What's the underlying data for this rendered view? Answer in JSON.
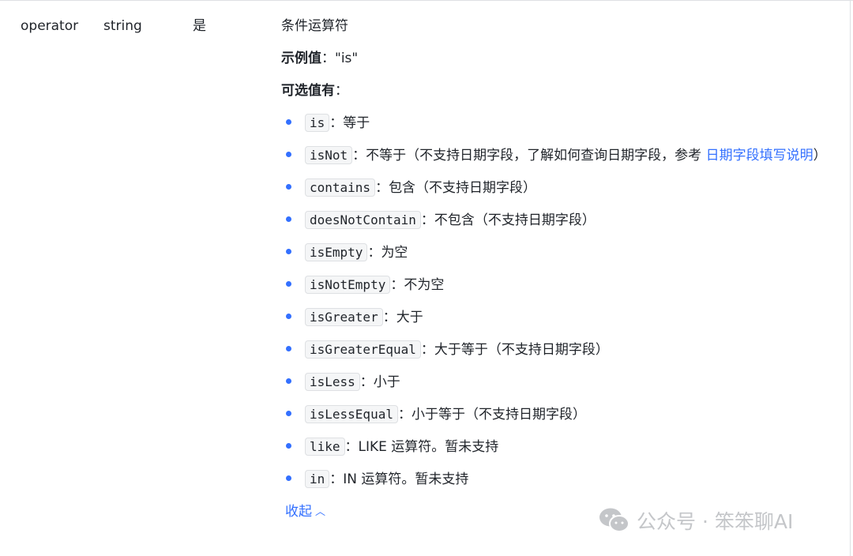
{
  "param": {
    "name": "operator",
    "type": "string",
    "required": "是",
    "description": "条件运算符",
    "example_label": "示例值",
    "example_sep": "：",
    "example_value": "\"is\"",
    "options_label": "可选值有",
    "options_sep": "："
  },
  "values": [
    {
      "code": "is",
      "sep": "：",
      "text": "等于"
    },
    {
      "code": "isNot",
      "sep": "：",
      "text": "不等于（不支持日期字段，了解如何查询日期字段，参考 ",
      "link": "日期字段填写说明",
      "tail": "）"
    },
    {
      "code": "contains",
      "sep": "：",
      "text": "包含（不支持日期字段）"
    },
    {
      "code": "doesNotContain",
      "sep": "：",
      "text": "不包含（不支持日期字段）"
    },
    {
      "code": "isEmpty",
      "sep": "：",
      "text": "为空"
    },
    {
      "code": "isNotEmpty",
      "sep": "：",
      "text": "不为空"
    },
    {
      "code": "isGreater",
      "sep": "：",
      "text": "大于"
    },
    {
      "code": "isGreaterEqual",
      "sep": "：",
      "text": "大于等于（不支持日期字段）"
    },
    {
      "code": "isLess",
      "sep": "：",
      "text": "小于"
    },
    {
      "code": "isLessEqual",
      "sep": "：",
      "text": "小于等于（不支持日期字段）"
    },
    {
      "code": "like",
      "sep": "：",
      "text": "LIKE 运算符。暂未支持"
    },
    {
      "code": "in",
      "sep": "：",
      "text": "IN 运算符。暂未支持"
    }
  ],
  "collapse_label": "收起",
  "watermark": {
    "text": "公众号 · 笨笨聊AI",
    "icon": "wechat-icon"
  },
  "colors": {
    "accent": "#3370ff",
    "text": "#1f2329",
    "watermark": "#c4c6c9"
  }
}
